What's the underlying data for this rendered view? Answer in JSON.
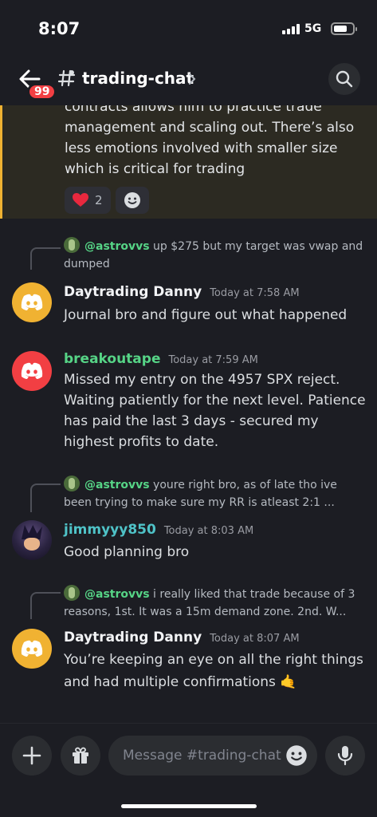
{
  "status": {
    "time": "8:07",
    "network": "5G"
  },
  "header": {
    "back_badge": "99",
    "channel": "trading-chat"
  },
  "highlight": {
    "text": "contracts allows him to practice trade management and scaling out. There’s also less emotions involved with smaller size which is critical for trading",
    "reactions": [
      {
        "emoji": "heart",
        "count": "2"
      },
      {
        "emoji": "add-reaction",
        "count": ""
      }
    ]
  },
  "messages": [
    {
      "reply_to": "@astrovvs",
      "reply_text": "up $275 but my target was vwap and dumped",
      "author": "Daytrading Danny",
      "timestamp": "Today at 7:58 AM",
      "text": "Journal bro and figure out what happened"
    },
    {
      "author": "breakoutape",
      "timestamp": "Today at 7:59 AM",
      "text": "Missed my entry on the 4957 SPX reject. Waiting patiently for the next level. Patience has paid the last 3 days - secured my highest profits to date."
    },
    {
      "reply_to": "@astrovvs",
      "reply_text": "youre right bro, as of late tho ive been trying to make sure my RR is atleast 2:1 ...",
      "author": "jimmyyy850",
      "timestamp": "Today at 8:03 AM",
      "text": "Good planning bro"
    },
    {
      "reply_to": "@astrovvs",
      "reply_text": "i really liked that trade because of 3 reasons, 1st. It was a 15m demand zone. 2nd. W...",
      "author": "Daytrading Danny",
      "timestamp": "Today at 8:07 AM",
      "text": "You’re keeping an eye on all the right things and had multiple confirmations 🤙"
    }
  ],
  "composer": {
    "placeholder": "Message #trading-chat"
  },
  "colors": {
    "background": "#1c1d23",
    "accent_orange": "#f0b232",
    "accent_red": "#f23f43",
    "mention_green": "#56d486"
  }
}
